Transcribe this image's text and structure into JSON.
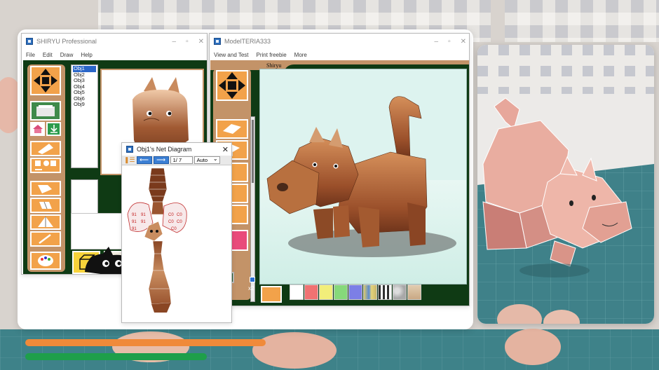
{
  "scene": {
    "progress_orange": 0.49,
    "progress_green": 0.37
  },
  "win1": {
    "title": "SHIRYU Professional",
    "menu": [
      "File",
      "Edit",
      "Draw",
      "Help"
    ],
    "objects": [
      "Obj1",
      "Obj2",
      "Obj3",
      "Obj4",
      "Obj5",
      "Obj6",
      "Obj9"
    ]
  },
  "win2": {
    "title": "ModelTERIA333",
    "menu": [
      "View and Test",
      "Print freebie",
      "More"
    ],
    "tab_label": "Shiryu",
    "multiplier": "x2"
  },
  "net": {
    "title": "Obj1's Net Diagram",
    "page": "1/ 7",
    "mode": "Auto",
    "label_a": "91",
    "label_b": "C0"
  },
  "colors": {
    "workspace": "#0f3a14",
    "accent": "#f2a24a",
    "palette": [
      "#ffffff",
      "#f07272",
      "#f2ee7a",
      "#86d97a",
      "#7c7fe6"
    ]
  }
}
